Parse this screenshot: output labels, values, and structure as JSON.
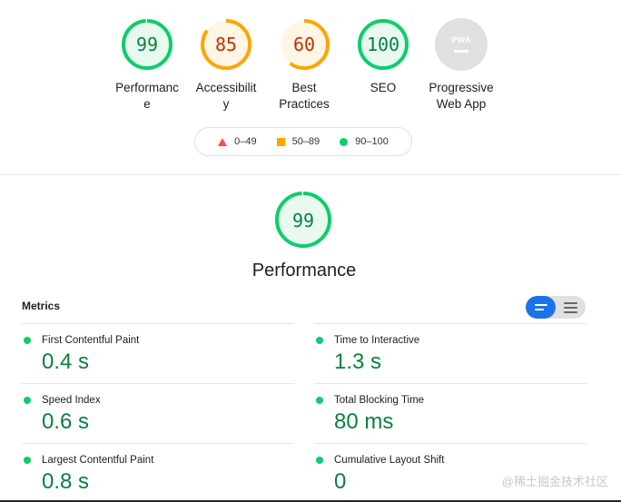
{
  "colors": {
    "pass": "#0cce6b",
    "average": "#ffa400",
    "fail": "#ff4e42",
    "pwa": "#e0e0e0",
    "accent": "#1a73e8"
  },
  "gauges": [
    {
      "score": "99",
      "score_value": 99,
      "label_line1": "Performanc",
      "label_line2": "e",
      "status": "pass"
    },
    {
      "score": "85",
      "score_value": 85,
      "label_line1": "Accessibilit",
      "label_line2": "y",
      "status": "average"
    },
    {
      "score": "60",
      "score_value": 60,
      "label_line1": "Best",
      "label_line2": "Practices",
      "status": "average"
    },
    {
      "score": "100",
      "score_value": 100,
      "label_line1": "SEO",
      "label_line2": "",
      "status": "pass"
    }
  ],
  "pwa": {
    "badge_text": "PWA",
    "label_line1": "Progressive",
    "label_line2": "Web App",
    "icon": "pwa-icon"
  },
  "legend": {
    "fail": "0–49",
    "average": "50–89",
    "pass": "90–100"
  },
  "performance": {
    "score": "99",
    "score_value": 99,
    "title": "Performance"
  },
  "metrics": {
    "heading": "Metrics",
    "view_toggle": {
      "active": "summary",
      "icons": [
        "summary-view-icon",
        "detail-view-icon"
      ]
    },
    "items": [
      {
        "name": "First Contentful Paint",
        "value": "0.4 s"
      },
      {
        "name": "Time to Interactive",
        "value": "1.3 s"
      },
      {
        "name": "Speed Index",
        "value": "0.6 s"
      },
      {
        "name": "Total Blocking Time",
        "value": "80 ms"
      },
      {
        "name": "Largest Contentful Paint",
        "value": "0.8 s"
      },
      {
        "name": "Cumulative Layout Shift",
        "value": "0"
      }
    ]
  },
  "watermark": "@稀土掘金技术社区"
}
